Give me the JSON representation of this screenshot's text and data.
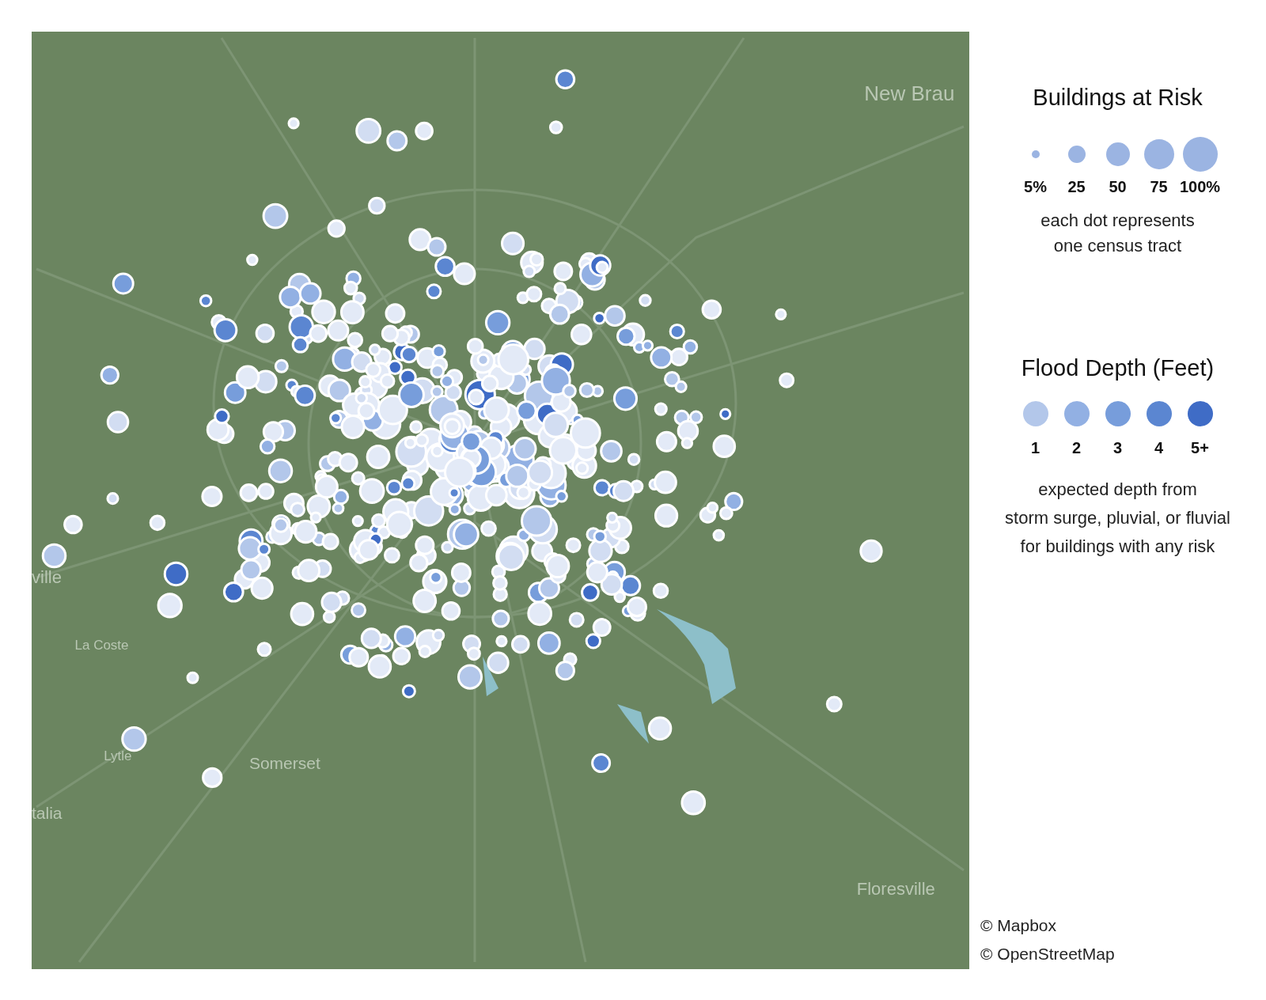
{
  "map": {
    "labels": [
      "New Brau",
      "ville",
      "La Coste",
      "Lytle",
      "Somerset",
      "talia",
      "Floresville"
    ]
  },
  "legend": {
    "size_title": "Buildings at Risk",
    "sizes": [
      {
        "label": "5%"
      },
      {
        "label": "25"
      },
      {
        "label": "50"
      },
      {
        "label": "75"
      },
      {
        "label": "100%"
      }
    ],
    "size_note": [
      "each dot represents",
      "one census tract"
    ],
    "depth_title": "Flood Depth (Feet)",
    "depths": [
      {
        "label": "1",
        "color": "#b3c7ea"
      },
      {
        "label": "2",
        "color": "#92b0e3"
      },
      {
        "label": "3",
        "color": "#779ddb"
      },
      {
        "label": "4",
        "color": "#5b86d1"
      },
      {
        "label": "5+",
        "color": "#3f6cc6"
      }
    ],
    "depth_note": [
      "expected depth from",
      "storm surge, pluvial, or fluvial",
      "for buildings with any risk"
    ]
  },
  "credits": [
    "© Mapbox",
    "© OpenStreetMap"
  ]
}
